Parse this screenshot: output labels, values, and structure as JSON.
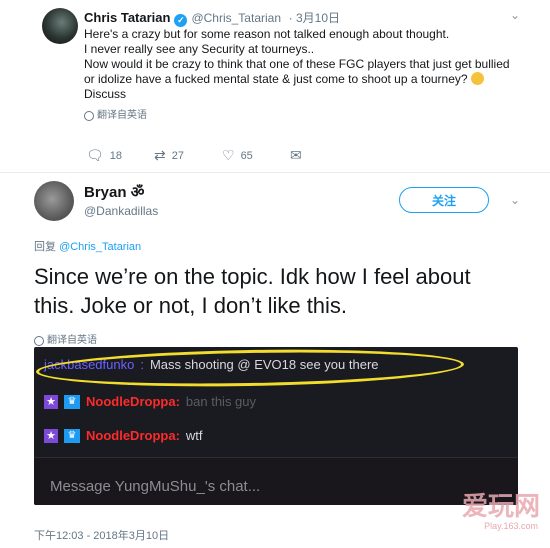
{
  "tweet1": {
    "name": "Chris Tatarian",
    "handle": "@Chris_Tatarian",
    "date": "· 3月10日",
    "lines": [
      "Here's a crazy but for some reason not talked enough about thought.",
      "I never really see any Security at tourneys..",
      "Now would it be crazy to think that one of these FGC players that just get bullied",
      "or idolize have a fucked mental state & just come to shoot up a tourney?",
      "Discuss"
    ],
    "translate_label": "翻译自英语",
    "actions": {
      "replies": "18",
      "retweets": "27",
      "likes": "65"
    }
  },
  "reply": {
    "name": "Bryan",
    "name_symbol": "ॐ",
    "handle": "@Dankadillas",
    "follow_label": "关注",
    "replying_prefix": "回复",
    "replying_to": "@Chris_Tatarian",
    "text_lines": [
      "Since we’re on the topic. Idk how I feel about",
      "this. Joke or not, I don’t like this."
    ],
    "translate_label": "翻译自英语",
    "timestamp": "下午12:03 - 2018年3月10日"
  },
  "chat": {
    "messages": [
      {
        "user": "jackbasedfunko",
        "text": "Mass shooting @ EVO18 see you there"
      },
      {
        "user": "NoodleDroppa",
        "text": "ban this guy"
      },
      {
        "user": "NoodleDroppa",
        "text": "wtf"
      }
    ],
    "input_placeholder": "Message YungMuShu_'s chat..."
  },
  "watermark": {
    "text": "爱玩网",
    "sub": "Play.163.com"
  },
  "colors": {
    "accent": "#1da1f2",
    "chat_bg": "#1a1a21",
    "highlight": "#f2dc2c",
    "red_user": "#ff2b2b"
  }
}
